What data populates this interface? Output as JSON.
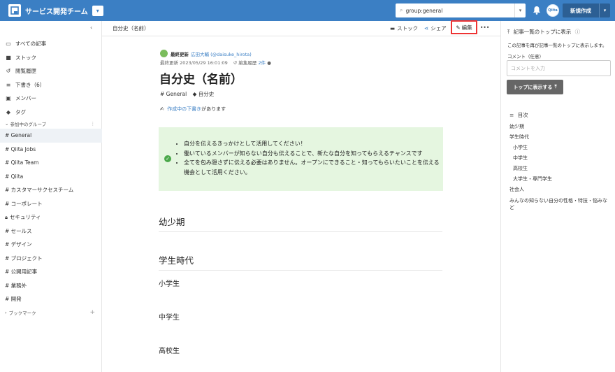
{
  "header": {
    "team_name": "サービス開発チーム",
    "search_value": "group:general",
    "avatar_text": "Qiita",
    "new_button": "新規作成"
  },
  "sidebar": {
    "nav": [
      {
        "icon": "inbox-icon",
        "label": "すべての記事"
      },
      {
        "icon": "folder-icon",
        "label": "ストック"
      },
      {
        "icon": "history-icon",
        "label": "閲覧履歴"
      },
      {
        "icon": "draft-icon",
        "label": "下書き（6）"
      },
      {
        "icon": "member-icon",
        "label": "メンバー"
      },
      {
        "icon": "tag-icon",
        "label": "タグ"
      }
    ],
    "groups_header": "参加中のグループ",
    "groups": [
      "# General",
      "# Qiita Jobs",
      "# Qiita Team",
      "# Qiita",
      "# カスタマーサクセスチーム",
      "# コーポレート",
      "セキュリティ",
      "# セールス",
      "# デザイン",
      "# プロジェクト",
      "# 公開用記事",
      "# 業務外",
      "# 開発"
    ],
    "bookmark_label": "ブックマーク"
  },
  "subbar": {
    "breadcrumb": "自分史（名前）",
    "stock": "ストック",
    "share": "シェア",
    "edit": "編集"
  },
  "article": {
    "last_updated_label": "最終更新",
    "author": "広田大輔 (@daisuke_hirota)",
    "updated_at": "最終更新 2023/05/29 16:01:09",
    "edit_history": "編集履歴",
    "edit_count": "2件",
    "title": "自分史（名前）",
    "tag_general": "# General",
    "tag_self": "自分史",
    "draft_link": "作成中の下書き",
    "draft_suffix": "があります",
    "note_items": [
      "自分を伝えるきっかけとして活用してください！",
      "働いているメンバーが知らない自分も伝えることで、新たな自分を知ってもらえるチャンスです",
      "全てを包み隠さずに伝える必要はありません。オープンにできること・知ってもらいたいことを伝える機会として活用ください。"
    ],
    "h2_childhood": "幼少期",
    "h2_school": "学生時代",
    "h3_elementary": "小学生",
    "h3_junior": "中学生",
    "h3_high": "高校生"
  },
  "right_panel": {
    "pin_heading": "記事一覧のトップに表示",
    "pin_desc": "この記事を再び記事一覧のトップに表示します。",
    "comment_label": "コメント（任意）",
    "comment_placeholder": "コメントを入力",
    "pin_button": "トップに表示する",
    "toc_heading": "目次",
    "toc": [
      {
        "label": "幼少期",
        "level": 1
      },
      {
        "label": "学生時代",
        "level": 1
      },
      {
        "label": "小学生",
        "level": 2
      },
      {
        "label": "中学生",
        "level": 2
      },
      {
        "label": "高校生",
        "level": 2
      },
      {
        "label": "大学生・専門学生",
        "level": 2
      },
      {
        "label": "社会人",
        "level": 1
      },
      {
        "label": "みんなの知らない自分の性格・特技・悩みなど",
        "level": 1
      }
    ]
  },
  "colors": {
    "header_bg": "#3b7fc4",
    "note_bg": "#e5f6e0",
    "highlight": "#ee3333"
  }
}
